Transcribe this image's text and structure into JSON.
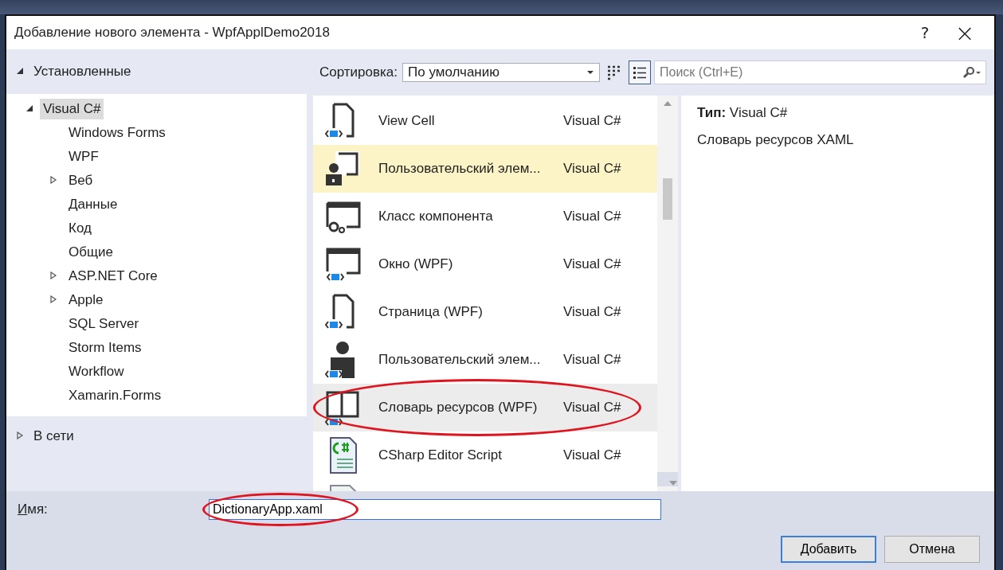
{
  "window": {
    "title": "Добавление нового элемента  - WpfApplDemo2018",
    "help_button": "?",
    "close_button": "×"
  },
  "sidebar": {
    "header": {
      "label": "Установленные",
      "expanded": true
    },
    "tree": [
      {
        "label": "Visual C#",
        "expanded": true,
        "selected": true,
        "children": [
          {
            "label": "Windows Forms",
            "selected": false
          },
          {
            "label": "WPF",
            "selected": false
          },
          {
            "label": "Веб",
            "expanded": false,
            "selected": false
          },
          {
            "label": "Данные",
            "selected": false
          },
          {
            "label": "Код",
            "selected": false
          },
          {
            "label": "Общие",
            "selected": false
          },
          {
            "label": "ASP.NET Core",
            "expanded": false,
            "selected": false
          },
          {
            "label": "Apple",
            "expanded": false,
            "selected": false
          },
          {
            "label": "SQL Server",
            "selected": false
          },
          {
            "label": "Storm Items",
            "selected": false
          },
          {
            "label": "Workflow",
            "selected": false
          },
          {
            "label": "Xamarin.Forms",
            "selected": false
          }
        ]
      }
    ],
    "online": {
      "label": "В сети",
      "expanded": false
    }
  },
  "toolbar": {
    "sort_label": "Сортировка:",
    "sort_value": "По умолчанию",
    "views": [
      {
        "kind": "small-icons",
        "selected": false
      },
      {
        "kind": "list",
        "selected": true
      }
    ],
    "search": {
      "placeholder": "Поиск (Ctrl+E)"
    }
  },
  "templates": [
    {
      "kind": "page",
      "name": "View Cell",
      "language": "Visual C#",
      "selected": false,
      "hovered": false
    },
    {
      "kind": "user-control",
      "name": "Пользовательский элем...",
      "language": "Visual C#",
      "selected": false,
      "hovered": true
    },
    {
      "kind": "component",
      "name": "Класс компонента",
      "language": "Visual C#",
      "selected": false,
      "hovered": false
    },
    {
      "kind": "window",
      "name": "Окно (WPF)",
      "language": "Visual C#",
      "selected": false,
      "hovered": false
    },
    {
      "kind": "page",
      "name": "Страница (WPF)",
      "language": "Visual C#",
      "selected": false,
      "hovered": false
    },
    {
      "kind": "person",
      "name": "Пользовательский элем...",
      "language": "Visual C#",
      "selected": false,
      "hovered": false
    },
    {
      "kind": "book",
      "name": "Словарь ресурсов (WPF)",
      "language": "Visual C#",
      "selected": true,
      "hovered": false,
      "circled": true
    },
    {
      "kind": "script",
      "name": "CSharp Editor Script",
      "language": "Visual C#",
      "selected": false,
      "hovered": false
    },
    {
      "kind": "blank-script",
      "selected": false,
      "hovered": false
    }
  ],
  "details": {
    "type": "**Тип:** Visual C#",
    "description": "Словарь ресурсов XAML"
  },
  "name_field": {
    "label": "Имя:",
    "value": "DictionaryApp.xaml",
    "circled": true
  },
  "buttons": [
    {
      "label": "Добавить",
      "default": true
    },
    {
      "label": "Отмена",
      "default": false
    }
  ]
}
